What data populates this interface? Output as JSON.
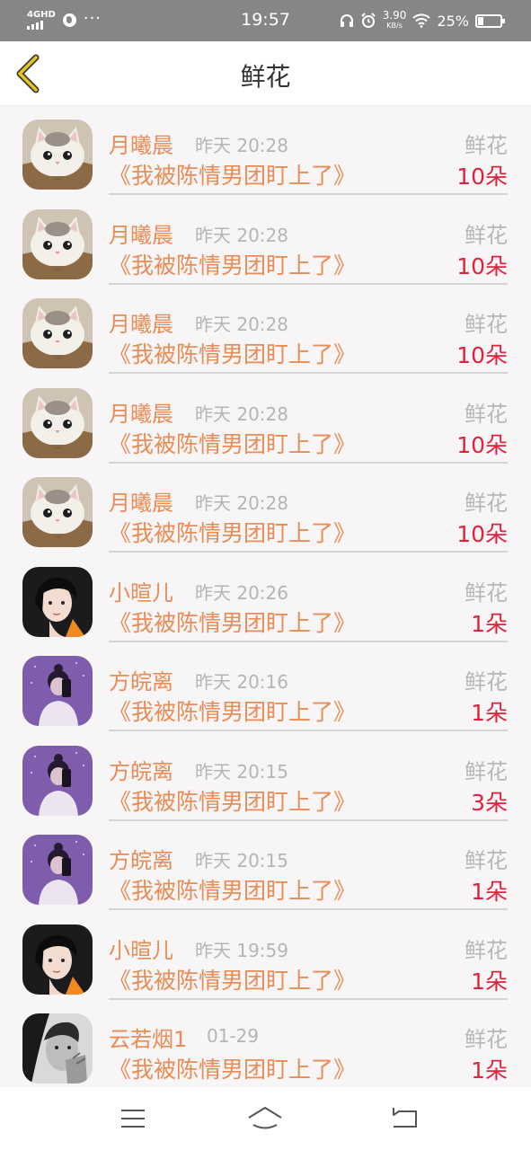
{
  "status_bar": {
    "network": "4GHD",
    "more": "···",
    "time": "19:57",
    "speed_value": "3.90",
    "speed_unit": "KB/s",
    "battery": "25%"
  },
  "header": {
    "title": "鲜花",
    "back_icon": "chevron-left-icon"
  },
  "rows": [
    {
      "name": "月曦晨",
      "time": "昨天 20:28",
      "type": "鲜花",
      "book": "《我被陈情男团盯上了》",
      "count": "10朵",
      "avatar": "cat-avatar"
    },
    {
      "name": "月曦晨",
      "time": "昨天 20:28",
      "type": "鲜花",
      "book": "《我被陈情男团盯上了》",
      "count": "10朵",
      "avatar": "cat-avatar"
    },
    {
      "name": "月曦晨",
      "time": "昨天 20:28",
      "type": "鲜花",
      "book": "《我被陈情男团盯上了》",
      "count": "10朵",
      "avatar": "cat-avatar"
    },
    {
      "name": "月曦晨",
      "time": "昨天 20:28",
      "type": "鲜花",
      "book": "《我被陈情男团盯上了》",
      "count": "10朵",
      "avatar": "cat-avatar"
    },
    {
      "name": "月曦晨",
      "time": "昨天 20:28",
      "type": "鲜花",
      "book": "《我被陈情男团盯上了》",
      "count": "10朵",
      "avatar": "cat-avatar"
    },
    {
      "name": "小暄儿",
      "time": "昨天 20:26",
      "type": "鲜花",
      "book": "《我被陈情男团盯上了》",
      "count": "1朵",
      "avatar": "boy-avatar"
    },
    {
      "name": "方皖离",
      "time": "昨天 20:16",
      "type": "鲜花",
      "book": "《我被陈情男团盯上了》",
      "count": "1朵",
      "avatar": "girl-avatar"
    },
    {
      "name": "方皖离",
      "time": "昨天 20:15",
      "type": "鲜花",
      "book": "《我被陈情男团盯上了》",
      "count": "3朵",
      "avatar": "girl-avatar"
    },
    {
      "name": "方皖离",
      "time": "昨天 20:15",
      "type": "鲜花",
      "book": "《我被陈情男团盯上了》",
      "count": "1朵",
      "avatar": "girl-avatar"
    },
    {
      "name": "小暄儿",
      "time": "昨天 19:59",
      "type": "鲜花",
      "book": "《我被陈情男团盯上了》",
      "count": "1朵",
      "avatar": "boy-avatar"
    },
    {
      "name": "云若烟1",
      "time": "01-29",
      "type": "鲜花",
      "book": "《我被陈情男团盯上了》",
      "count": "1朵",
      "avatar": "bw-avatar"
    }
  ],
  "nav": {
    "menu_icon": "menu-icon",
    "home_icon": "home-icon",
    "back_icon": "back-icon"
  },
  "colors": {
    "accent_orange": "#e98c55",
    "count_red": "#e0233d",
    "muted_gray": "#b5b5b5",
    "back_yellow": "#e8c21e"
  }
}
